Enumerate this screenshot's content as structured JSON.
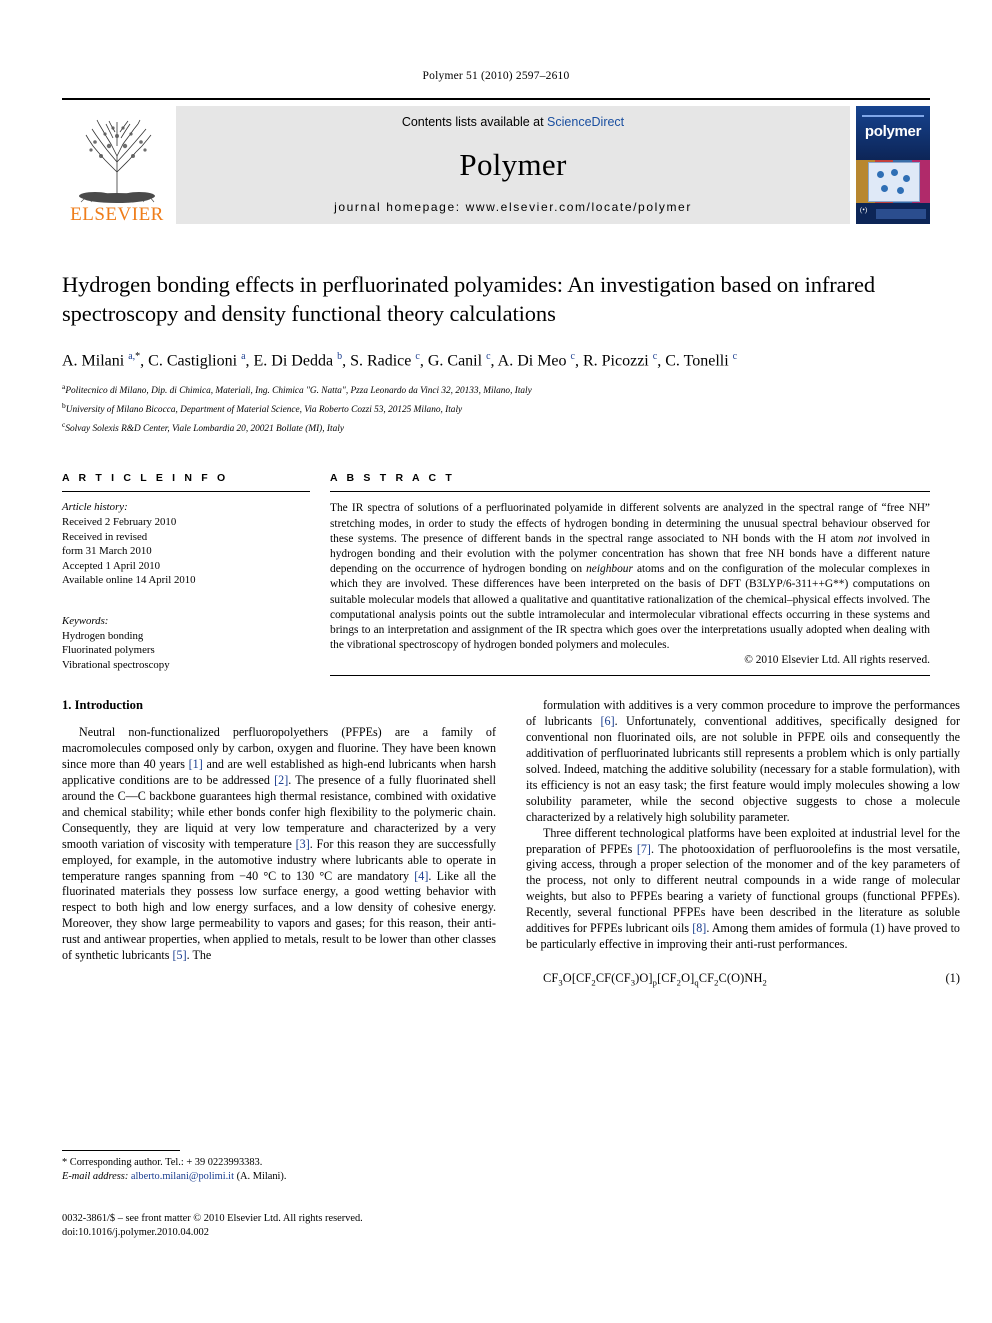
{
  "running_head": "Polymer 51 (2010) 2597–2610",
  "masthead": {
    "publisher": "ELSEVIER",
    "contents_prefix": "Contents lists available at ",
    "contents_link": "ScienceDirect",
    "journal_name": "Polymer",
    "homepage": "journal homepage: www.elsevier.com/locate/polymer",
    "cover_title": "polymer",
    "link_color": "#1a4fa0",
    "elsevier_orange": "#ef7d1a"
  },
  "article": {
    "title": "Hydrogen bonding effects in perfluorinated polyamides: An investigation based on infrared spectroscopy and density functional theory calculations",
    "authors_html": "A. Milani <sup>a,<span class=\"star-sup\">*</span></sup>, C. Castiglioni <sup>a</sup>, E. Di Dedda <sup>b</sup>, S. Radice <sup>c</sup>, G. Canil <sup>c</sup>, A. Di Meo <sup>c</sup>, R. Picozzi <sup>c</sup>, C. Tonelli <sup>c</sup>",
    "affiliations": [
      {
        "marker": "a",
        "text": "Politecnico di Milano, Dip. di Chimica, Materiali, Ing. Chimica \"G. Natta\", Pzza Leonardo da Vinci 32, 20133, Milano, Italy"
      },
      {
        "marker": "b",
        "text": "University of Milano Bicocca, Department of Material Science, Via Roberto Cozzi 53, 20125 Milano, Italy"
      },
      {
        "marker": "c",
        "text": "Solvay Solexis R&D Center, Viale Lombardia 20, 20021 Bollate (MI), Italy"
      }
    ]
  },
  "article_info": {
    "heading": "A R T I C L E  I N F O",
    "history_label": "Article history:",
    "history": [
      "Received 2 February 2010",
      "Received in revised",
      "form 31 March 2010",
      "Accepted 1 April 2010",
      "Available online 14 April 2010"
    ],
    "keywords_label": "Keywords:",
    "keywords": [
      "Hydrogen bonding",
      "Fluorinated polymers",
      "Vibrational spectroscopy"
    ]
  },
  "abstract": {
    "heading": "A B S T R A C T",
    "text_html": "The IR spectra of solutions of a perfluorinated polyamide in different solvents are analyzed in the spectral range of “free NH” stretching modes, in order to study the effects of hydrogen bonding in determining the unusual spectral behaviour observed for these systems. The presence of different bands in the spectral range associated to NH bonds with the H atom <em>not</em> involved in hydrogen bonding and their evolution with the polymer concentration has shown that free NH bonds have a different nature depending on the occurrence of hydrogen bonding on <em>neighbour</em> atoms and on the configuration of the molecular complexes in which they are involved. These differences have been interpreted on the basis of DFT (B3LYP/6-311++G**) computations on suitable molecular models that allowed a qualitative and quantitative rationalization of the chemical–physical effects involved. The computational analysis points out the subtle intramolecular and intermolecular vibrational effects occurring in these systems and brings to an interpretation and assignment of the IR spectra which goes over the interpretations usually adopted when dealing with the vibrational spectroscopy of hydrogen bonded polymers and molecules.",
    "copyright": "© 2010 Elsevier Ltd. All rights reserved."
  },
  "introduction": {
    "heading": "1. Introduction",
    "left_paragraphs_html": [
      "Neutral non-functionalized perfluoropolyethers (PFPEs) are a family of macromolecules composed only by carbon, oxygen and fluorine. They have been known since more than 40 years <span class=\"ref\">[1]</span> and are well established as high-end lubricants when harsh applicative conditions are to be addressed <span class=\"ref\">[2]</span>. The presence of a fully fluorinated shell around the C—C backbone guarantees high thermal resistance, combined with oxidative and chemical stability; while ether bonds confer high flexibility to the polymeric chain. Consequently, they are liquid at very low temperature and characterized by a very smooth variation of viscosity with temperature <span class=\"ref\">[3]</span>. For this reason they are successfully employed, for example, in the automotive industry where lubricants able to operate in temperature ranges spanning from −40 °C to 130 °C are mandatory <span class=\"ref\">[4]</span>. Like all the fluorinated materials they possess low surface energy, a good wetting behavior with respect to both high and low energy surfaces, and a low density of cohesive energy. Moreover, they show large permeability to vapors and gases; for this reason, their anti-rust and antiwear properties, when applied to metals, result to be lower than other classes of synthetic lubricants <span class=\"ref\">[5]</span>. The"
    ],
    "right_paragraphs_html": [
      "formulation with additives is a very common procedure to improve the performances of lubricants <span class=\"ref\">[6]</span>. Unfortunately, conventional additives, specifically designed for conventional non fluorinated oils, are not soluble in PFPE oils and consequently the additivation of perfluorinated lubricants still represents a problem which is only partially solved. Indeed, matching the additive solubility (necessary for a stable formulation), with its efficiency is not an easy task; the first feature would imply molecules showing a low solubility parameter, while the second objective suggests to chose a molecule characterized by a relatively high solubility parameter.",
      "Three different technological platforms have been exploited at industrial level for the preparation of PFPEs <span class=\"ref\">[7]</span>. The photooxidation of perfluoroolefins is the most versatile, giving access, through a proper selection of the monomer and of the key parameters of the process, not only to different neutral compounds in a wide range of molecular weights, but also to PFPEs bearing a variety of functional groups (functional PFPEs). Recently, several functional PFPEs have been described in the literature as soluble additives for PFPEs lubricant oils <span class=\"ref\">[8]</span>. Among them amides of formula (1) have proved to be particularly effective in improving their anti-rust performances."
    ]
  },
  "equation": {
    "formula_html": "CF<sub>3</sub>O[CF<sub>2</sub>CF(CF<sub>3</sub>)O]<sub>p</sub>[CF<sub>2</sub>O]<sub>q</sub>CF<sub>2</sub>C(O)NH<sub>2</sub>",
    "number": "(1)"
  },
  "footnotes": {
    "corresponding_html": "* Corresponding author. Tel.: + 39 0223993383.",
    "email_label": "E-mail address:",
    "email": "alberto.milani@polimi.it",
    "email_suffix": " (A. Milani)."
  },
  "imprint": {
    "issn_line": "0032-3861/$ – see front matter © 2010 Elsevier Ltd. All rights reserved.",
    "doi_line": "doi:10.1016/j.polymer.2010.04.002"
  }
}
